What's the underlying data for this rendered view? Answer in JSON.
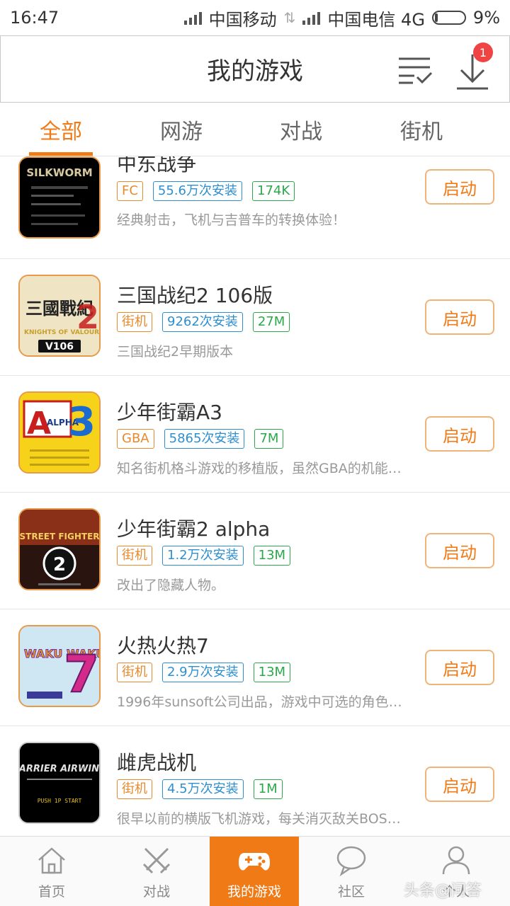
{
  "status": {
    "time": "16:47",
    "carrier1": "中国移动",
    "carrier2": "中国电信 4G",
    "battery": "9%",
    "battery_level": 0.09
  },
  "header": {
    "title": "我的游戏",
    "badge_count": "1",
    "icons": [
      "list-check-icon",
      "download-icon"
    ]
  },
  "tabs": [
    {
      "label": "全部",
      "active": true
    },
    {
      "label": "网游",
      "active": false
    },
    {
      "label": "对战",
      "active": false
    },
    {
      "label": "街机",
      "active": false
    }
  ],
  "games": [
    {
      "name": "中东战争",
      "platform": "FC",
      "installs": "55.6万次安装",
      "size": "174K",
      "desc": "经典射击，飞机与吉普车的转换体验！",
      "button": "启动"
    },
    {
      "name": "三国战纪2 106版",
      "platform": "街机",
      "installs": "9262次安装",
      "size": "27M",
      "desc": "三国战纪2早期版本",
      "button": "启动"
    },
    {
      "name": "少年街霸A3",
      "platform": "GBA",
      "installs": "5865次安装",
      "size": "7M",
      "desc": "知名街机格斗游戏的移植版，虽然GBA的机能…",
      "button": "启动"
    },
    {
      "name": "少年街霸2 alpha",
      "platform": "街机",
      "installs": "1.2万次安装",
      "size": "13M",
      "desc": "改出了隐藏人物。",
      "button": "启动"
    },
    {
      "name": "火热火热7",
      "platform": "街机",
      "installs": "2.9万次安装",
      "size": "13M",
      "desc": "1996年sunsoft公司出品，游戏中可选的角色…",
      "button": "启动"
    },
    {
      "name": "雌虎战机",
      "platform": "街机",
      "installs": "4.5万次安装",
      "size": "1M",
      "desc": "很早以前的横版飞机游戏，每关消灭敌关BOS…",
      "button": "启动"
    }
  ],
  "thumb_text": {
    "g1_title": "SILKWORM",
    "g2_title": "三國戰紀",
    "g2_sub": "KNIGHTS OF VALOUR",
    "g2_ver": "V106",
    "g3_title": "ALPHA",
    "g3_num": "3",
    "g4_title": "STREET FIGHTER",
    "g5_title": "WAKU WAKU",
    "g5_num": "7",
    "g6_title": "CARRIER AIRWING",
    "g6_sub": "PUSH 1P START"
  },
  "bottom_nav": [
    {
      "label": "首页",
      "icon": "home-icon"
    },
    {
      "label": "对战",
      "icon": "swords-icon"
    },
    {
      "label": "我的游戏",
      "icon": "gamepad-icon",
      "active": true
    },
    {
      "label": "社区",
      "icon": "chat-bubble-icon"
    },
    {
      "label": "个人",
      "icon": "person-icon"
    }
  ],
  "watermark": "头条@问答"
}
